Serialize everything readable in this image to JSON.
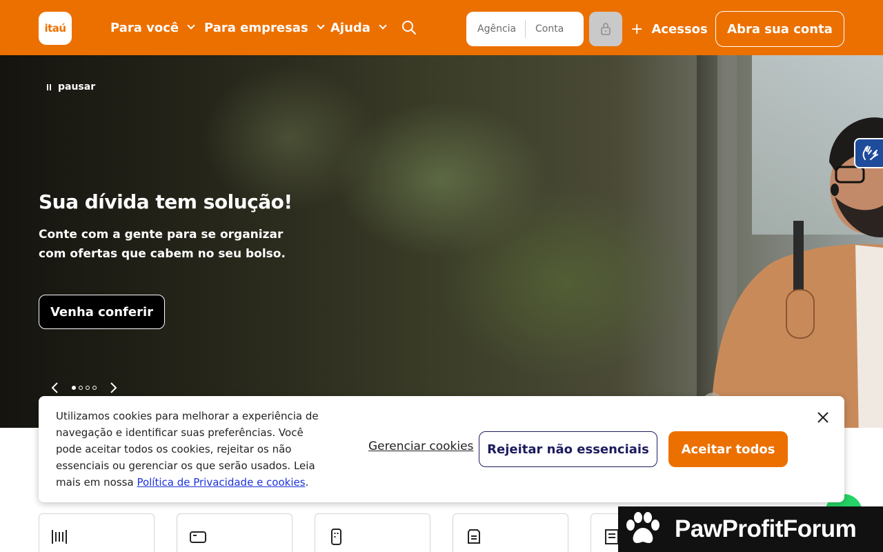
{
  "header": {
    "logo_text": "itaú",
    "nav": [
      {
        "label": "Para você"
      },
      {
        "label": "Para empresas"
      },
      {
        "label": "Ajuda"
      }
    ],
    "login": {
      "agencia_placeholder": "Agência",
      "conta_placeholder": "Conta"
    },
    "acessos_label": "Acessos",
    "abra_conta_label": "Abra sua conta",
    "brand_color": "#ec7000"
  },
  "hero": {
    "pause_label": "pausar",
    "title": "Sua dívida tem solução!",
    "subtitle": "Conte com a gente para se organizar com ofertas que cabem no seu bolso.",
    "cta_label": "Venha conferir",
    "slides_total": 4,
    "active_slide": 1
  },
  "cookie": {
    "text": "Utilizamos cookies para melhorar a experiência de navegação e identificar suas preferências. Você pode aceitar todos os cookies, rejeitar os não essenciais ou gerenciar os que serão usados. Leia mais em nossa ",
    "link": "Política de Privacidade e cookies",
    "link_suffix": ".",
    "manage_label": "Gerenciar cookies",
    "reject_label": "Rejeitar não essenciais",
    "accept_label": "Aceitar todos"
  },
  "cards": [
    {
      "icon": "barcode-icon"
    },
    {
      "icon": "card-icon"
    },
    {
      "icon": "phone-icon"
    },
    {
      "icon": "document-icon"
    },
    {
      "icon": "list-icon"
    }
  ],
  "watermark": {
    "text": "PawProfitForum"
  }
}
